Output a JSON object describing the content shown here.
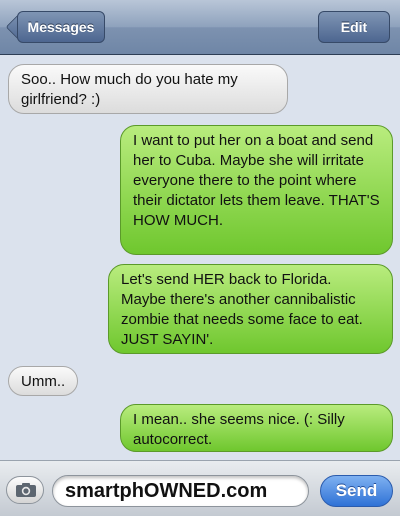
{
  "navbar": {
    "back_label": "Messages",
    "edit_label": "Edit"
  },
  "messages": [
    {
      "side": "received",
      "text": "Soo.. How much do you hate my girlfriend? :)"
    },
    {
      "side": "sent",
      "text": "I want to put her on a boat and send her to Cuba. Maybe she will irritate everyone there to the point where their dictator lets them leave. THAT'S HOW MUCH."
    },
    {
      "side": "sent",
      "text": "Let's send HER back to Florida. Maybe there's another cannibalistic zombie that needs some face to eat. JUST SAYIN'."
    },
    {
      "side": "received",
      "text": "Umm.."
    },
    {
      "side": "sent",
      "text": "I mean.. she seems nice. (: Silly autocorrect."
    }
  ],
  "compose": {
    "field_text": "smartphOWNED.com",
    "send_label": "Send",
    "camera_icon": "camera-icon"
  },
  "colors": {
    "sent_bubble": "#8fd64f",
    "received_bubble": "#e6e6e6",
    "send_button": "#3f83e2",
    "nav_bar": "#8ea2bd"
  }
}
